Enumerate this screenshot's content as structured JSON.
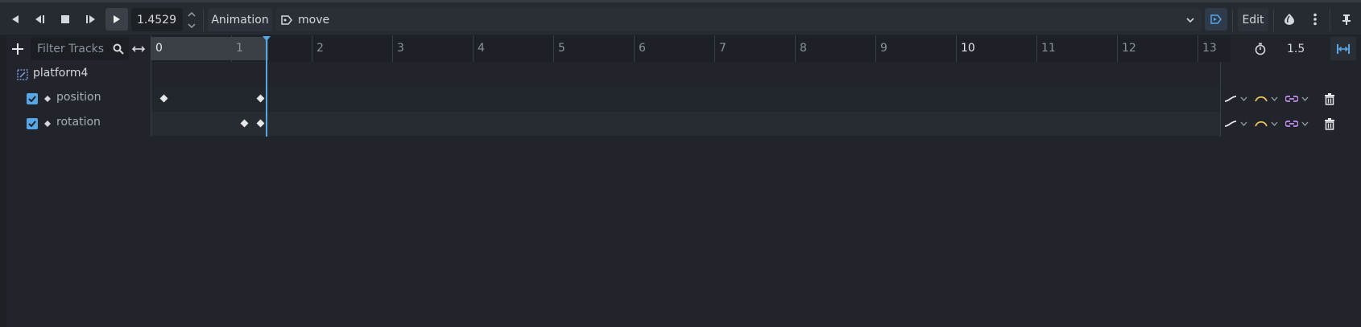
{
  "toolbar": {
    "time_value": "1.4529",
    "animation_label": "Animation",
    "animation_name": "move",
    "edit_label": "Edit"
  },
  "track_header": {
    "filter_placeholder": "Filter Tracks",
    "length_value": "1.5"
  },
  "timeline": {
    "ticks": [
      "0",
      "1",
      "2",
      "3",
      "4",
      "5",
      "6",
      "7",
      "8",
      "9",
      "10",
      "11",
      "12",
      "13"
    ],
    "playhead_time": 1.4529
  },
  "tracks": {
    "node_name": "platform4",
    "items": [
      {
        "label": "position",
        "keyframes": [
          0.1,
          1.3
        ]
      },
      {
        "label": "rotation",
        "keyframes": [
          1.1,
          1.3
        ]
      }
    ]
  },
  "colors": {
    "accent": "#57a6e6",
    "interp_icon": "#f0c55a",
    "loop_icon": "#c48ff0"
  }
}
